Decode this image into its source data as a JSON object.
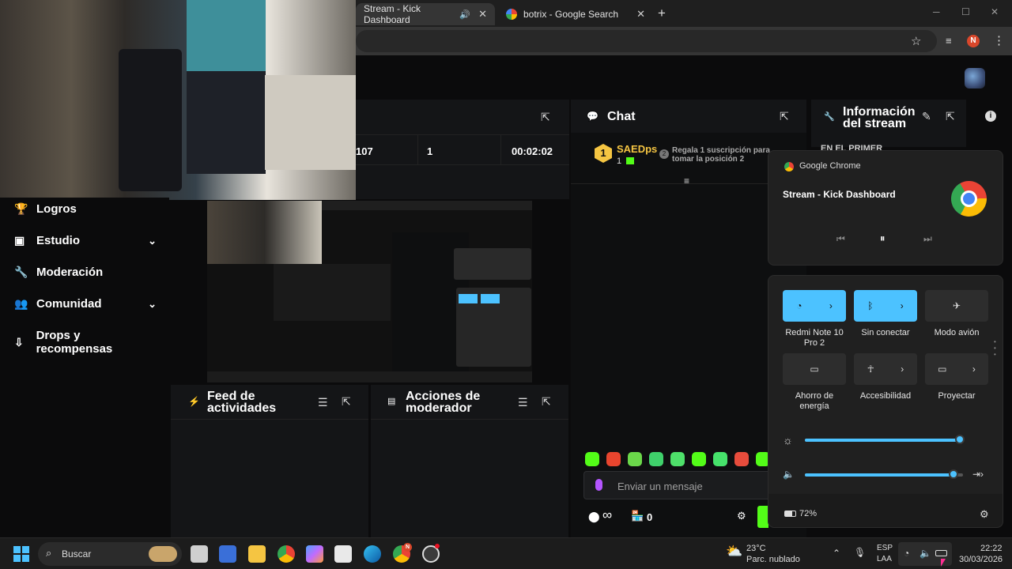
{
  "browser": {
    "tabs": [
      {
        "label": "Stream - Kick Dashboard",
        "active": true
      },
      {
        "label": "botrix - Google Search",
        "active": false
      }
    ],
    "profile_initial": "N"
  },
  "stats": {
    "viewers": "107",
    "value2": "1",
    "uptime": "00:02:02"
  },
  "sidebar": {
    "items": [
      {
        "label": "Logros",
        "icon": "trophy-icon",
        "expandable": false
      },
      {
        "label": "Estudio",
        "icon": "studio-icon",
        "expandable": true
      },
      {
        "label": "Moderación",
        "icon": "wrench-icon",
        "expandable": false
      },
      {
        "label": "Comunidad",
        "icon": "community-icon",
        "expandable": true
      },
      {
        "label": "Drops y recompensas",
        "icon": "drops-icon",
        "expandable": false
      }
    ]
  },
  "chat": {
    "title": "Chat",
    "leader": {
      "rank": "1",
      "name": "SAEDps",
      "count": "1"
    },
    "promo": "Regala 1 suscripción para tomar la posición 2",
    "input_placeholder": "Enviar un mensaje",
    "points": "0",
    "infinity": "∞"
  },
  "info": {
    "title_line1": "Información",
    "title_line2": "del stream",
    "subtitle": "EN EL PRIMER"
  },
  "panels": {
    "feed_title_1": "Feed de",
    "feed_title_2": "actividades",
    "mod_title_1": "Acciones de",
    "mod_title_2": "moderador"
  },
  "media": {
    "app": "Google Chrome",
    "title": "Stream - Kick Dashboard"
  },
  "quick": {
    "tiles": [
      {
        "label": "Redmi Note 10 Pro 2",
        "icon": "wifi-icon",
        "on": true
      },
      {
        "label": "Sin conectar",
        "icon": "bluetooth-icon",
        "on": true
      },
      {
        "label": "Modo avión",
        "icon": "airplane-icon",
        "on": false
      },
      {
        "label": "Ahorro de energía",
        "icon": "battery-saver-icon",
        "on": false
      },
      {
        "label": "Accesibilidad",
        "icon": "accessibility-icon",
        "on": false
      },
      {
        "label": "Proyectar",
        "icon": "cast-icon",
        "on": false
      }
    ],
    "brightness": 0.98,
    "volume": 0.94,
    "battery": "72%"
  },
  "taskbar": {
    "search": "Buscar",
    "weather_temp": "23°C",
    "weather_desc": "Parc. nublado",
    "lang1": "ESP",
    "lang2": "LAA",
    "time": "22:22",
    "date": "30/03/2026",
    "chrome_badge": "N"
  },
  "colors": {
    "accent_green": "#53fc18",
    "quick_on": "#4cc2ff",
    "gold": "#f5c542"
  }
}
